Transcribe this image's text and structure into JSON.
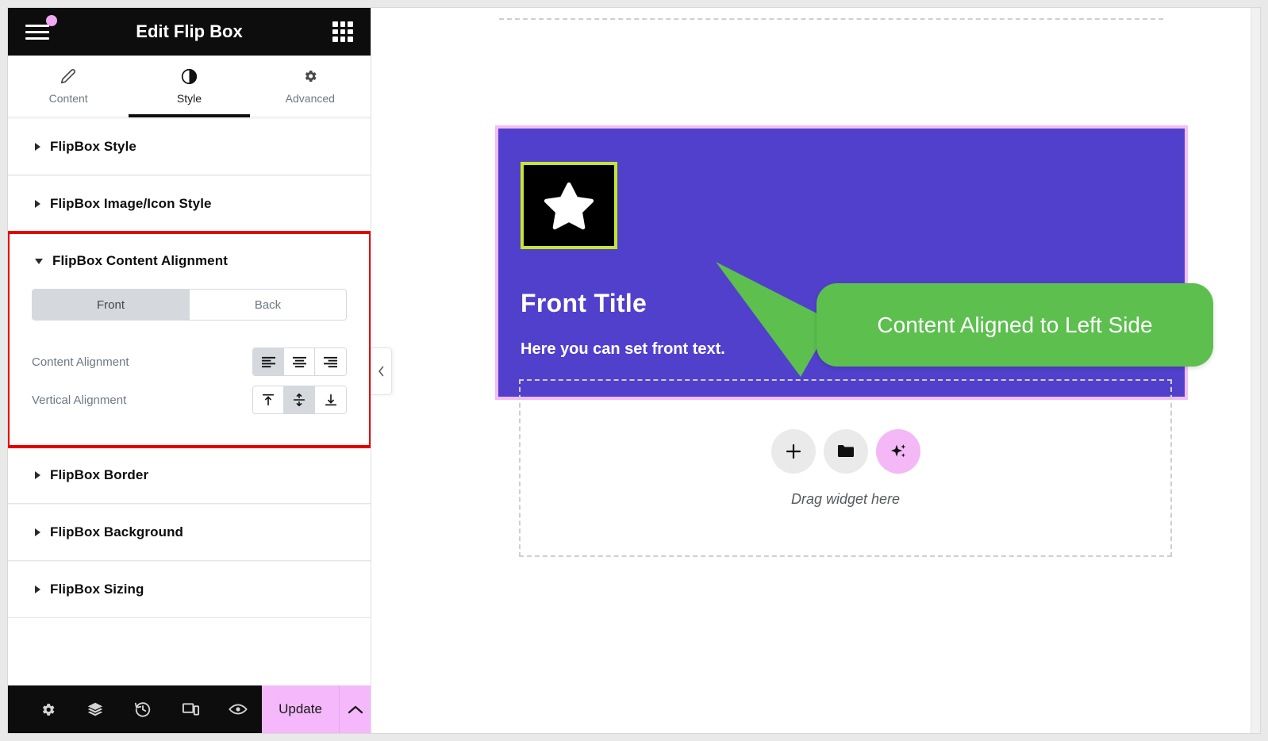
{
  "panel": {
    "header": {
      "title": "Edit Flip Box",
      "menu_icon": "hamburger-icon",
      "apps_icon": "grid-apps-icon"
    },
    "tabs": [
      {
        "label": "Content",
        "icon": "pencil-icon",
        "active": false
      },
      {
        "label": "Style",
        "icon": "contrast-half-circle-icon",
        "active": true
      },
      {
        "label": "Advanced",
        "icon": "gear-icon",
        "active": false
      }
    ],
    "sections": [
      {
        "title": "FlipBox Style",
        "open": false,
        "highlighted": false
      },
      {
        "title": "FlipBox Image/Icon Style",
        "open": false,
        "highlighted": false
      },
      {
        "title": "FlipBox Content Alignment",
        "open": true,
        "highlighted": true
      },
      {
        "title": "FlipBox Border",
        "open": false,
        "highlighted": false
      },
      {
        "title": "FlipBox Background",
        "open": false,
        "highlighted": false
      },
      {
        "title": "FlipBox Sizing",
        "open": false,
        "highlighted": false
      }
    ],
    "content_alignment": {
      "side_switch": {
        "options": [
          "Front",
          "Back"
        ],
        "selected": "Front"
      },
      "content_alignment": {
        "label": "Content Alignment",
        "options": [
          "align-left",
          "align-center",
          "align-right"
        ],
        "selected": "align-left"
      },
      "vertical_alignment": {
        "label": "Vertical Alignment",
        "options": [
          "align-top",
          "align-middle",
          "align-bottom"
        ],
        "selected": "align-middle"
      }
    },
    "footer": {
      "tools": [
        {
          "icon": "gear-settings-icon",
          "name": "settings"
        },
        {
          "icon": "layers-navigator-icon",
          "name": "navigator"
        },
        {
          "icon": "history-clock-icon",
          "name": "history"
        },
        {
          "icon": "responsive-devices-icon",
          "name": "responsive-mode"
        },
        {
          "icon": "eye-preview-icon",
          "name": "preview"
        }
      ],
      "update_label": "Update",
      "update_caret_icon": "chevron-up-icon"
    },
    "collapse_handle_icon": "chevron-left-icon"
  },
  "canvas": {
    "flipbox": {
      "icon": "star-icon",
      "title": "Front Title",
      "text": "Here you can set front text.",
      "background_color": "#5140CC",
      "icon_box_background": "#000000",
      "icon_box_border_color": "#C7E52E",
      "selection_outline_color": "#F3BDF8"
    },
    "callout": {
      "text": "Content Aligned to Left Side",
      "color": "#5CBF4E"
    },
    "dropzone": {
      "label": "Drag widget here",
      "buttons": [
        {
          "icon": "plus-icon",
          "name": "add-element"
        },
        {
          "icon": "folder-icon",
          "name": "templates"
        },
        {
          "icon": "sparkle-ai-icon",
          "name": "ai-builder"
        }
      ]
    }
  },
  "colors": {
    "panel_header_bg": "#0D0D0D",
    "accent_pink": "#F5B8FA",
    "highlight_red": "#E50000",
    "flipbox_purple": "#5140CC",
    "callout_green": "#5CBF4E",
    "icon_border_green": "#C7E52E"
  }
}
